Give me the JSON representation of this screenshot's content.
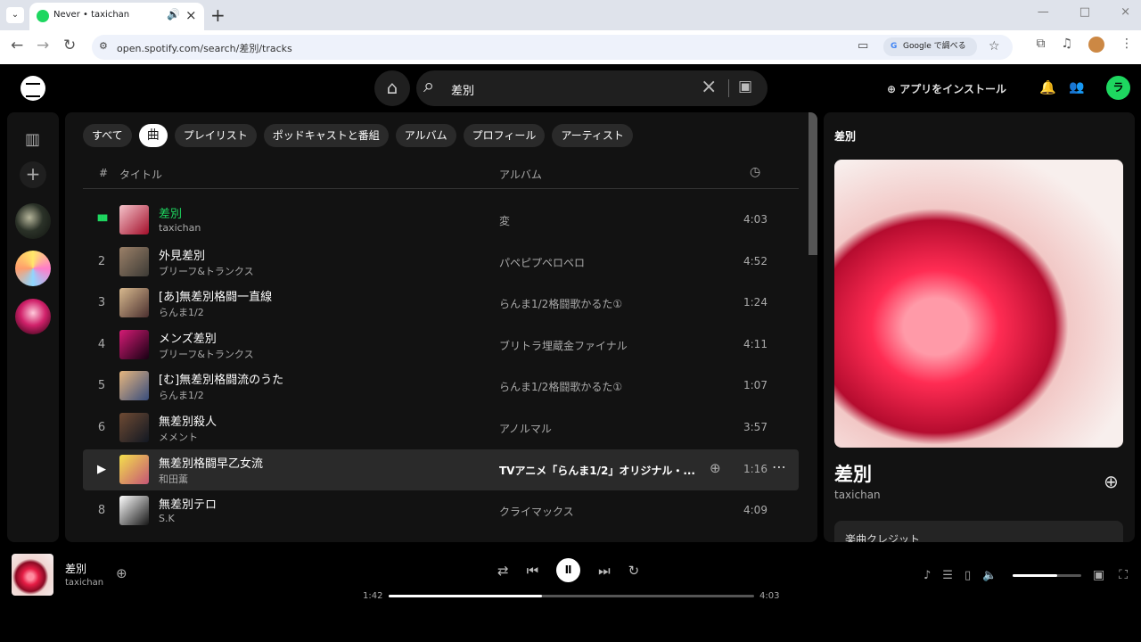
{
  "browser": {
    "tab_title": "Never • taxichan",
    "url": "open.spotify.com/search/差別/tracks",
    "google_button": "Google で調べる"
  },
  "header": {
    "search_value": "差別",
    "install_label": "アプリをインストール",
    "avatar_letter": "ラ"
  },
  "filters": [
    "すべて",
    "曲",
    "プレイリスト",
    "ポッドキャストと番組",
    "アルバム",
    "プロフィール",
    "アーティスト"
  ],
  "table": {
    "number_header": "#",
    "title_header": "タイトル",
    "album_header": "アルバム"
  },
  "tracks": [
    {
      "number": "",
      "title": "差別",
      "artist": "taxichan",
      "album": "変",
      "duration": "4:03",
      "state": "playing",
      "colors": [
        "#f4c3ca",
        "#a30e2a"
      ]
    },
    {
      "number": "2",
      "title": "外見差別",
      "artist": "ブリーフ&トランクス",
      "album": "パペピプペロペロ",
      "duration": "4:52",
      "state": "",
      "colors": [
        "#9b8068",
        "#3c3a35"
      ]
    },
    {
      "number": "3",
      "title": "[あ]無差別格闘一直線",
      "artist": "らんま1/2",
      "album": "らんま1/2格闘歌かるた①",
      "duration": "1:24",
      "state": "",
      "colors": [
        "#d8b98e",
        "#4b302f"
      ]
    },
    {
      "number": "4",
      "title": "メンズ差別",
      "artist": "ブリーフ&トランクス",
      "album": "ブリトラ埋蔵金ファイナル",
      "duration": "4:11",
      "state": "",
      "colors": [
        "#d51b75",
        "#160012"
      ]
    },
    {
      "number": "5",
      "title": "[む]無差別格闘流のうた",
      "artist": "らんま1/2",
      "album": "らんま1/2格闘歌かるた①",
      "duration": "1:07",
      "state": "",
      "colors": [
        "#e7b67e",
        "#384d7d"
      ]
    },
    {
      "number": "6",
      "title": "無差別殺人",
      "artist": "メメント",
      "album": "アノルマル",
      "duration": "3:57",
      "state": "",
      "colors": [
        "#6e4a33",
        "#121822"
      ]
    },
    {
      "number": "",
      "title": "無差別格闘早乙女流",
      "artist": "和田薫",
      "album": "TVアニメ「らんま1/2」オリジナル・...",
      "duration": "1:16",
      "state": "hover",
      "colors": [
        "#f4e04c",
        "#c55575"
      ]
    },
    {
      "number": "8",
      "title": "無差別テロ",
      "artist": "S.K",
      "album": "クライマックス",
      "duration": "4:09",
      "state": "",
      "colors": [
        "#ffffff",
        "#161616"
      ]
    }
  ],
  "right_panel": {
    "heading": "差別",
    "song": "差別",
    "artist": "taxichan",
    "credits_label": "楽曲クレジット"
  },
  "player": {
    "title": "差別",
    "artist": "taxichan",
    "elapsed": "1:42",
    "total": "4:03",
    "progress": 0.42,
    "volume": 0.65
  }
}
